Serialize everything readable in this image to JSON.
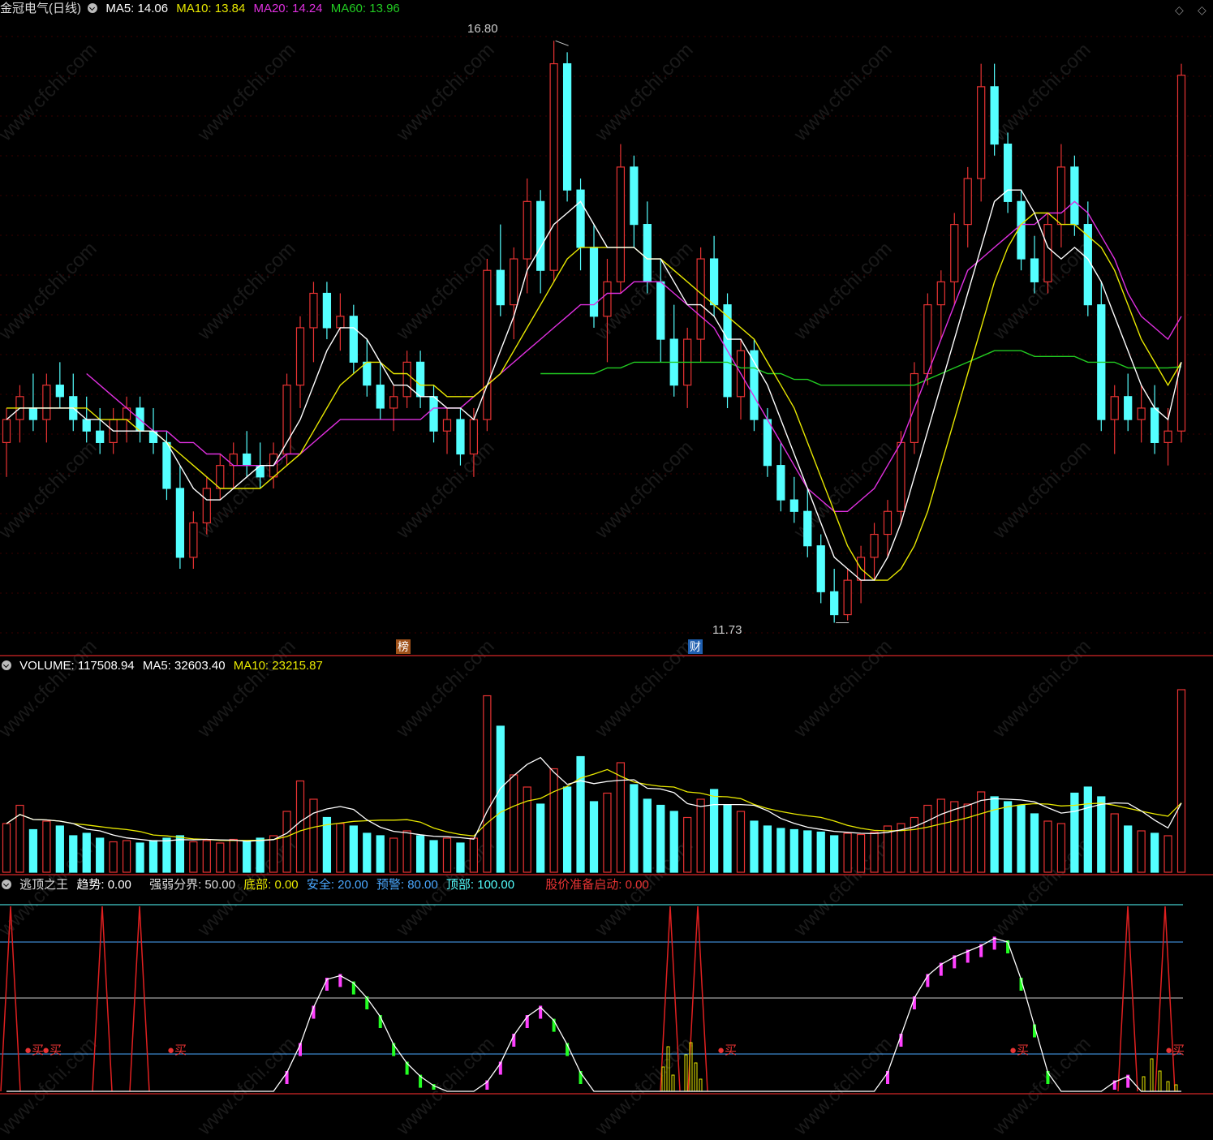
{
  "price_panel": {
    "title": "金冠电气(日线)",
    "ma5_label": "MA5: 14.06",
    "ma10_label": "MA10: 13.84",
    "ma20_label": "MA20: 14.24",
    "ma60_label": "MA60: 13.96",
    "high_label": "16.80",
    "low_label": "11.73",
    "badge_bang": "榜",
    "badge_cai": "财",
    "colors": {
      "up": "#e83333",
      "down": "#54ffff",
      "ma5": "#ffffff",
      "ma10": "#e8e800",
      "ma20": "#e030e0",
      "ma60": "#22cc22"
    }
  },
  "volume_panel": {
    "volume_label": "VOLUME: 117508.94",
    "ma5_label": "MA5: 32603.40",
    "ma10_label": "MA10: 23215.87"
  },
  "indicator_panel": {
    "name": "逃顶之王",
    "trend_label": "趋势: 0.00",
    "divide_label": "强弱分界: 50.00",
    "bottom_label": "底部: 0.00",
    "safe_label": "安全: 20.00",
    "warn_label": "预警: 80.00",
    "top_label": "顶部: 100.00",
    "launch_label": "股价准备启动: 0.00",
    "buy_text": "买"
  },
  "watermark": "www.cfchi.com",
  "chart_data": {
    "type": "candlestick",
    "ylim": [
      11.5,
      17.0
    ],
    "ohlc": [
      [
        13.3,
        13.6,
        13.0,
        13.5
      ],
      [
        13.5,
        13.8,
        13.3,
        13.7
      ],
      [
        13.6,
        13.9,
        13.4,
        13.5
      ],
      [
        13.5,
        13.9,
        13.3,
        13.8
      ],
      [
        13.8,
        14.0,
        13.6,
        13.7
      ],
      [
        13.7,
        13.9,
        13.4,
        13.5
      ],
      [
        13.5,
        13.7,
        13.3,
        13.4
      ],
      [
        13.4,
        13.6,
        13.2,
        13.3
      ],
      [
        13.3,
        13.6,
        13.2,
        13.5
      ],
      [
        13.5,
        13.7,
        13.3,
        13.6
      ],
      [
        13.6,
        13.7,
        13.3,
        13.4
      ],
      [
        13.4,
        13.6,
        13.2,
        13.3
      ],
      [
        13.3,
        13.4,
        12.8,
        12.9
      ],
      [
        12.9,
        13.1,
        12.2,
        12.3
      ],
      [
        12.3,
        12.7,
        12.2,
        12.6
      ],
      [
        12.6,
        13.0,
        12.5,
        12.9
      ],
      [
        12.9,
        13.2,
        12.8,
        13.1
      ],
      [
        13.1,
        13.3,
        12.9,
        13.2
      ],
      [
        13.2,
        13.4,
        13.0,
        13.1
      ],
      [
        13.1,
        13.3,
        12.9,
        13.0
      ],
      [
        13.0,
        13.3,
        12.9,
        13.2
      ],
      [
        13.2,
        13.9,
        13.1,
        13.8
      ],
      [
        13.8,
        14.4,
        13.6,
        14.3
      ],
      [
        14.3,
        14.7,
        14.0,
        14.6
      ],
      [
        14.6,
        14.7,
        14.2,
        14.3
      ],
      [
        14.3,
        14.6,
        14.1,
        14.4
      ],
      [
        14.4,
        14.5,
        13.9,
        14.0
      ],
      [
        14.0,
        14.2,
        13.7,
        13.8
      ],
      [
        13.8,
        14.0,
        13.5,
        13.6
      ],
      [
        13.6,
        13.8,
        13.4,
        13.7
      ],
      [
        13.7,
        14.1,
        13.6,
        14.0
      ],
      [
        14.0,
        14.1,
        13.6,
        13.7
      ],
      [
        13.7,
        13.8,
        13.3,
        13.4
      ],
      [
        13.4,
        13.6,
        13.2,
        13.5
      ],
      [
        13.5,
        13.6,
        13.1,
        13.2
      ],
      [
        13.2,
        13.6,
        13.0,
        13.5
      ],
      [
        13.5,
        14.9,
        13.4,
        14.8
      ],
      [
        14.8,
        15.2,
        14.4,
        14.5
      ],
      [
        14.5,
        15.0,
        14.2,
        14.9
      ],
      [
        14.9,
        15.6,
        14.6,
        15.4
      ],
      [
        15.4,
        15.5,
        14.6,
        14.8
      ],
      [
        14.8,
        16.8,
        14.7,
        16.6
      ],
      [
        16.6,
        16.7,
        15.4,
        15.5
      ],
      [
        15.5,
        15.6,
        14.8,
        15.0
      ],
      [
        15.0,
        15.2,
        14.3,
        14.4
      ],
      [
        14.4,
        14.9,
        14.0,
        14.7
      ],
      [
        14.7,
        15.9,
        14.6,
        15.7
      ],
      [
        15.7,
        15.8,
        15.0,
        15.2
      ],
      [
        15.2,
        15.4,
        14.6,
        14.7
      ],
      [
        14.7,
        14.9,
        14.0,
        14.2
      ],
      [
        14.2,
        14.5,
        13.7,
        13.8
      ],
      [
        13.8,
        14.3,
        13.6,
        14.2
      ],
      [
        14.2,
        15.0,
        14.0,
        14.9
      ],
      [
        14.9,
        15.1,
        14.4,
        14.5
      ],
      [
        14.5,
        14.6,
        13.6,
        13.7
      ],
      [
        13.7,
        14.2,
        13.5,
        14.1
      ],
      [
        14.1,
        14.2,
        13.4,
        13.5
      ],
      [
        13.5,
        13.6,
        13.0,
        13.1
      ],
      [
        13.1,
        13.3,
        12.7,
        12.8
      ],
      [
        12.8,
        13.0,
        12.6,
        12.7
      ],
      [
        12.7,
        12.9,
        12.3,
        12.4
      ],
      [
        12.4,
        12.5,
        11.9,
        12.0
      ],
      [
        12.0,
        12.2,
        11.73,
        11.8
      ],
      [
        11.8,
        12.2,
        11.75,
        12.1
      ],
      [
        12.1,
        12.4,
        11.9,
        12.3
      ],
      [
        12.3,
        12.6,
        12.1,
        12.5
      ],
      [
        12.5,
        12.8,
        12.3,
        12.7
      ],
      [
        12.7,
        13.4,
        12.6,
        13.3
      ],
      [
        13.3,
        14.0,
        13.2,
        13.9
      ],
      [
        13.9,
        14.6,
        13.8,
        14.5
      ],
      [
        14.5,
        14.8,
        14.2,
        14.7
      ],
      [
        14.7,
        15.3,
        14.5,
        15.2
      ],
      [
        15.2,
        15.7,
        15.0,
        15.6
      ],
      [
        15.6,
        16.6,
        15.4,
        16.4
      ],
      [
        16.4,
        16.6,
        15.8,
        15.9
      ],
      [
        15.9,
        16.0,
        15.3,
        15.4
      ],
      [
        15.4,
        15.5,
        14.8,
        14.9
      ],
      [
        14.9,
        15.1,
        14.6,
        14.7
      ],
      [
        14.7,
        15.3,
        14.6,
        15.2
      ],
      [
        15.2,
        15.9,
        15.0,
        15.7
      ],
      [
        15.7,
        15.8,
        15.1,
        15.2
      ],
      [
        15.2,
        15.4,
        14.4,
        14.5
      ],
      [
        14.5,
        14.7,
        13.4,
        13.5
      ],
      [
        13.5,
        13.8,
        13.2,
        13.7
      ],
      [
        13.7,
        13.9,
        13.4,
        13.5
      ],
      [
        13.5,
        13.8,
        13.3,
        13.6
      ],
      [
        13.6,
        13.8,
        13.2,
        13.3
      ],
      [
        13.3,
        13.6,
        13.1,
        13.4
      ],
      [
        13.4,
        16.6,
        13.3,
        16.5
      ]
    ],
    "ma5": [
      13.5,
      13.6,
      13.6,
      13.6,
      13.6,
      13.6,
      13.5,
      13.5,
      13.4,
      13.4,
      13.4,
      13.4,
      13.3,
      13.1,
      12.9,
      12.8,
      12.8,
      12.9,
      13.0,
      13.1,
      13.1,
      13.3,
      13.5,
      13.8,
      14.1,
      14.3,
      14.3,
      14.2,
      14.0,
      13.8,
      13.8,
      13.7,
      13.7,
      13.6,
      13.6,
      13.5,
      13.8,
      14.1,
      14.4,
      14.8,
      15.0,
      15.2,
      15.3,
      15.4,
      15.2,
      15.0,
      15.0,
      15.0,
      14.9,
      14.9,
      14.7,
      14.5,
      14.5,
      14.4,
      14.2,
      14.2,
      14.0,
      13.8,
      13.5,
      13.2,
      12.9,
      12.6,
      12.3,
      12.2,
      12.1,
      12.1,
      12.3,
      12.6,
      13.0,
      13.4,
      13.8,
      14.2,
      14.6,
      15.0,
      15.4,
      15.5,
      15.5,
      15.3,
      15.0,
      14.9,
      15.0,
      14.9,
      14.7,
      14.4,
      14.1,
      13.8,
      13.6,
      13.5,
      14.0
    ],
    "ma10": [
      13.6,
      13.6,
      13.6,
      13.6,
      13.6,
      13.6,
      13.6,
      13.5,
      13.5,
      13.5,
      13.4,
      13.4,
      13.3,
      13.2,
      13.1,
      13.0,
      12.9,
      12.9,
      12.9,
      12.9,
      13.0,
      13.1,
      13.2,
      13.4,
      13.6,
      13.8,
      13.9,
      14.0,
      14.0,
      13.9,
      13.9,
      13.8,
      13.8,
      13.7,
      13.7,
      13.7,
      13.8,
      13.9,
      14.1,
      14.3,
      14.5,
      14.7,
      14.9,
      15.0,
      15.0,
      15.0,
      15.0,
      15.0,
      14.9,
      14.9,
      14.8,
      14.7,
      14.6,
      14.5,
      14.4,
      14.3,
      14.2,
      14.0,
      13.8,
      13.6,
      13.3,
      13.0,
      12.7,
      12.4,
      12.2,
      12.1,
      12.1,
      12.2,
      12.4,
      12.7,
      13.1,
      13.5,
      13.9,
      14.3,
      14.7,
      15.0,
      15.2,
      15.3,
      15.3,
      15.2,
      15.2,
      15.1,
      15.0,
      14.8,
      14.5,
      14.2,
      14.0,
      13.8,
      14.0
    ],
    "ma20": [
      null,
      null,
      null,
      null,
      null,
      null,
      13.9,
      13.8,
      13.7,
      13.6,
      13.5,
      13.4,
      13.4,
      13.3,
      13.3,
      13.2,
      13.2,
      13.1,
      13.1,
      13.1,
      13.1,
      13.2,
      13.2,
      13.3,
      13.4,
      13.5,
      13.5,
      13.5,
      13.5,
      13.5,
      13.5,
      13.5,
      13.6,
      13.6,
      13.6,
      13.7,
      13.8,
      13.9,
      14.0,
      14.1,
      14.2,
      14.3,
      14.4,
      14.5,
      14.5,
      14.6,
      14.6,
      14.7,
      14.7,
      14.7,
      14.6,
      14.5,
      14.4,
      14.3,
      14.1,
      13.9,
      13.7,
      13.5,
      13.3,
      13.1,
      12.9,
      12.8,
      12.7,
      12.7,
      12.8,
      12.9,
      13.1,
      13.3,
      13.6,
      13.9,
      14.2,
      14.5,
      14.8,
      14.9,
      15.0,
      15.1,
      15.2,
      15.2,
      15.3,
      15.3,
      15.4,
      15.3,
      15.1,
      14.9,
      14.6,
      14.4,
      14.3,
      14.2,
      14.4
    ],
    "ma60": [
      null,
      null,
      null,
      null,
      null,
      null,
      null,
      null,
      null,
      null,
      null,
      null,
      null,
      null,
      null,
      null,
      null,
      null,
      null,
      null,
      null,
      null,
      null,
      null,
      null,
      null,
      null,
      null,
      null,
      null,
      null,
      null,
      null,
      null,
      null,
      null,
      null,
      null,
      null,
      null,
      13.9,
      13.9,
      13.9,
      13.9,
      13.9,
      13.95,
      13.95,
      14.0,
      14.0,
      14.0,
      14.0,
      14.0,
      14.0,
      14.0,
      14.0,
      13.95,
      13.95,
      13.9,
      13.9,
      13.85,
      13.85,
      13.8,
      13.8,
      13.8,
      13.8,
      13.8,
      13.8,
      13.8,
      13.8,
      13.85,
      13.9,
      13.95,
      14.0,
      14.05,
      14.1,
      14.1,
      14.1,
      14.05,
      14.05,
      14.05,
      14.05,
      14.0,
      14.0,
      14.0,
      13.95,
      13.95,
      13.95,
      13.95,
      13.96
    ],
    "volume": [
      40,
      55,
      35,
      42,
      38,
      30,
      32,
      28,
      25,
      26,
      24,
      26,
      28,
      30,
      25,
      26,
      24,
      27,
      25,
      28,
      30,
      50,
      75,
      60,
      45,
      40,
      38,
      32,
      30,
      28,
      34,
      30,
      26,
      28,
      24,
      28,
      145,
      120,
      80,
      70,
      56,
      85,
      70,
      95,
      58,
      65,
      90,
      72,
      60,
      55,
      50,
      45,
      60,
      68,
      55,
      50,
      42,
      38,
      36,
      35,
      34,
      33,
      30,
      32,
      31,
      33,
      38,
      40,
      45,
      55,
      60,
      58,
      56,
      66,
      62,
      58,
      55,
      48,
      42,
      40,
      65,
      70,
      62,
      48,
      38,
      34,
      32,
      30,
      150
    ],
    "volume_max": 160,
    "indicator": [
      0,
      0,
      0,
      0,
      0,
      0,
      0,
      0,
      0,
      0,
      0,
      0,
      0,
      0,
      0,
      0,
      0,
      0,
      0,
      0,
      0,
      10,
      25,
      45,
      60,
      62,
      58,
      50,
      40,
      25,
      15,
      8,
      3,
      0,
      0,
      0,
      5,
      15,
      30,
      40,
      45,
      38,
      25,
      10,
      0,
      0,
      0,
      0,
      0,
      0,
      0,
      0,
      0,
      0,
      0,
      0,
      0,
      0,
      0,
      0,
      0,
      0,
      0,
      0,
      0,
      0,
      10,
      30,
      50,
      62,
      68,
      72,
      75,
      78,
      82,
      80,
      60,
      35,
      10,
      0,
      0,
      0,
      0,
      5,
      8,
      0,
      0,
      0,
      0
    ],
    "indicator_levels": {
      "bottom": 0,
      "safe": 20,
      "divide": 50,
      "warn": 80,
      "top": 100
    }
  }
}
